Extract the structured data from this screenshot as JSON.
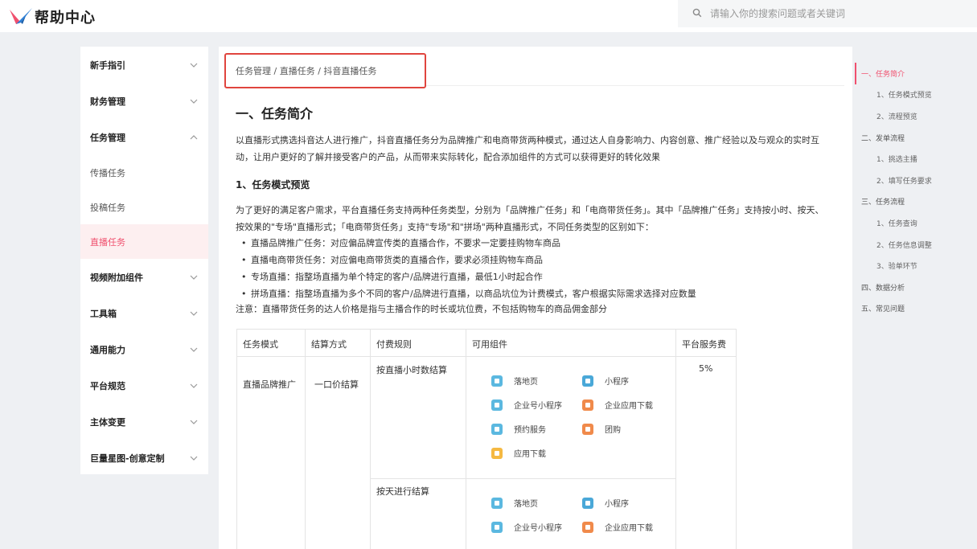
{
  "header": {
    "logo_text": "帮助中心",
    "search_placeholder": "请输入你的搜索问题或者关键词",
    "brand_color": "#f0506e"
  },
  "sidebar": {
    "items": [
      {
        "label": "新手指引",
        "type": "group",
        "expanded": false
      },
      {
        "label": "财务管理",
        "type": "group",
        "expanded": false
      },
      {
        "label": "任务管理",
        "type": "group",
        "expanded": true
      },
      {
        "label": "传播任务",
        "type": "sub"
      },
      {
        "label": "投稿任务",
        "type": "sub"
      },
      {
        "label": "直播任务",
        "type": "sub",
        "active": true
      },
      {
        "label": "视频附加组件",
        "type": "group",
        "expanded": false
      },
      {
        "label": "工具箱",
        "type": "group",
        "expanded": false
      },
      {
        "label": "通用能力",
        "type": "group",
        "expanded": false
      },
      {
        "label": "平台规范",
        "type": "group",
        "expanded": false
      },
      {
        "label": "主体变更",
        "type": "group",
        "expanded": false
      },
      {
        "label": "巨量星图-创意定制",
        "type": "group",
        "expanded": false
      }
    ]
  },
  "main": {
    "breadcrumb": "任务管理 / 直播任务 / 抖音直播任务",
    "title": "一、任务简介",
    "intro_line1": "以直播形式携选抖音达人进行推广，抖音直播任务分为品牌推广和电商带货两种模式，通过达人自身影响力、内容创意、推广经验以及与观众的实时互",
    "intro_line2": "动，让用户更好的了解并接受客户的产品，从而带来实际转化，配合添加组件的方式可以获得更好的转化效果",
    "section_title": "1、任务模式预览",
    "section_line1": "为了更好的满足客户需求，平台直播任务支持两种任务类型，分别为「品牌推广任务」和「电商带货任务」。其中「品牌推广任务」支持按小时、按天、",
    "section_line2": "按效果的\"专场\"直播形式；「电商带货任务」支持\"专场\"和\"拼场\"两种直播形式，不同任务类型的区别如下：",
    "bullets": [
      "直播品牌推广任务：对应偏品牌宣传类的直播合作，不要求一定要挂购物车商品",
      "直播电商带货任务：对应偏电商带货类的直播合作，要求必须挂购物车商品",
      "专场直播：指整场直播为单个特定的客户/品牌进行直播，最低1小时起合作",
      "拼场直播：指整场直播为多个不同的客户/品牌进行直播，以商品坑位为计费模式，客户根据实际需求选择对应数量"
    ],
    "note": "注意：直播带货任务的达人价格是指与主播合作的时长或坑位费，不包括购物车的商品佣金部分",
    "table": {
      "headers": [
        "任务模式",
        "结算方式",
        "付费规则",
        "可用组件",
        "平台服务费"
      ],
      "mode": "直播品牌推广",
      "settlement": "一口价结算",
      "fee": "5%",
      "rule1": "按直播小时数结算",
      "rule2": "按天进行结算",
      "components1": [
        {
          "name": "落地页",
          "icon": "landing-page-icon",
          "color": "#5bb8e0"
        },
        {
          "name": "小程序",
          "icon": "mini-program-icon",
          "color": "#4aa8d8"
        },
        {
          "name": "企业号小程序",
          "icon": "enterprise-mini-program-icon",
          "color": "#5bb8e0"
        },
        {
          "name": "企业应用下载",
          "icon": "enterprise-app-download-icon",
          "color": "#f08a4b"
        },
        {
          "name": "预约服务",
          "icon": "booking-service-icon",
          "color": "#5bb8e0"
        },
        {
          "name": "团购",
          "icon": "group-buy-icon",
          "color": "#f08a4b"
        },
        {
          "name": "应用下载",
          "icon": "app-download-icon",
          "color": "#f5b942"
        }
      ],
      "components2": [
        {
          "name": "落地页",
          "icon": "landing-page-icon",
          "color": "#5bb8e0"
        },
        {
          "name": "小程序",
          "icon": "mini-program-icon",
          "color": "#4aa8d8"
        },
        {
          "name": "企业号小程序",
          "icon": "enterprise-mini-program-icon",
          "color": "#5bb8e0"
        },
        {
          "name": "企业应用下载",
          "icon": "enterprise-app-download-icon",
          "color": "#f08a4b"
        }
      ]
    }
  },
  "toc": {
    "items": [
      {
        "label": "一、任务简介",
        "level": 1,
        "active": true
      },
      {
        "label": "1、任务模式预览",
        "level": 2
      },
      {
        "label": "2、流程预览",
        "level": 2
      },
      {
        "label": "二、发单流程",
        "level": 1
      },
      {
        "label": "1、挑选主播",
        "level": 2
      },
      {
        "label": "2、填写任务要求",
        "level": 2
      },
      {
        "label": "三、任务流程",
        "level": 1
      },
      {
        "label": "1、任务查询",
        "level": 2
      },
      {
        "label": "2、任务信息调整",
        "level": 2
      },
      {
        "label": "3、验单环节",
        "level": 2
      },
      {
        "label": "四、数据分析",
        "level": 1
      },
      {
        "label": "五、常见问题",
        "level": 1
      }
    ]
  }
}
